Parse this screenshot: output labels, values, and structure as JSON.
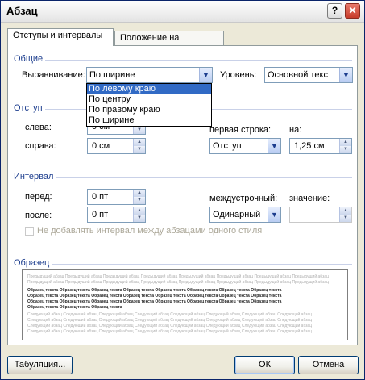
{
  "window": {
    "title": "Абзац",
    "help_label": "?",
    "close_label": "✕"
  },
  "tabs": [
    {
      "label": "Отступы и интервалы",
      "active": true
    },
    {
      "label": "Положение на странице",
      "active": false
    }
  ],
  "general": {
    "title": "Общие",
    "alignment_label": "Выравнивание:",
    "alignment_value": "По ширине",
    "alignment_options": [
      "По левому краю",
      "По центру",
      "По правому краю",
      "По ширине"
    ],
    "level_label": "Уровень:",
    "level_value": "Основной текст"
  },
  "indent": {
    "title": "Отступ",
    "left_label": "слева:",
    "left_value": "0 см",
    "right_label": "справа:",
    "right_value": "0 см",
    "first_line_label": "первая строка:",
    "first_line_value": "Отступ",
    "by_label": "на:",
    "by_value": "1,25 см"
  },
  "spacing": {
    "title": "Интервал",
    "before_label": "перед:",
    "before_value": "0 пт",
    "after_label": "после:",
    "after_value": "0 пт",
    "line_spacing_label": "междустрочный:",
    "line_spacing_value": "Одинарный",
    "value_label": "значение:",
    "value_value": "",
    "no_space_label": "Не добавлять интервал между абзацами одного стиля"
  },
  "preview": {
    "title": "Образец",
    "prev_text": "Предыдущий абзац Предыдущий абзац Предыдущий абзац Предыдущий абзац Предыдущий абзац Предыдущий абзац Предыдущий абзац Предыдущий абзац",
    "sample_text": "Образец текста Образец текста Образец текста Образец текста Образец текста Образец текста Образец текста Образец текста",
    "sample_last": "Образец текста Образец текста Образец текста",
    "next_text": "Следующий абзац Следующий абзац Следующий абзац Следующий абзац Следующий абзац Следующий абзац Следующий абзац Следующий абзац"
  },
  "buttons": {
    "tabs_label": "Табуляция...",
    "ok_label": "ОК",
    "cancel_label": "Отмена"
  }
}
